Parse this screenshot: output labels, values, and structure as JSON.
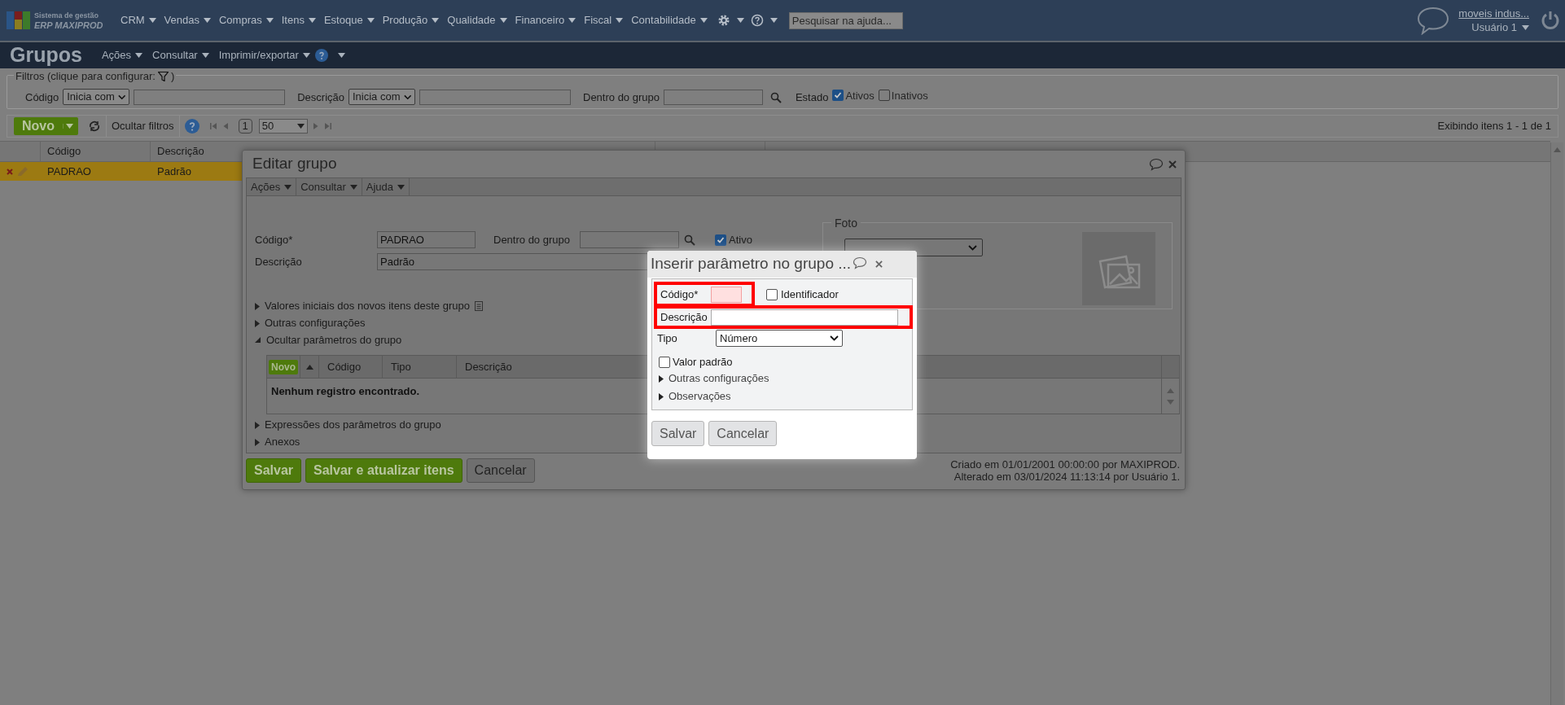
{
  "top_bar": {
    "logo": {
      "line1": "Sistema de gestão",
      "line2": "ERP MAXIPROD"
    },
    "menu": [
      {
        "label": "CRM"
      },
      {
        "label": "Vendas"
      },
      {
        "label": "Compras"
      },
      {
        "label": "Itens"
      },
      {
        "label": "Estoque"
      },
      {
        "label": "Produção"
      },
      {
        "label": "Qualidade"
      },
      {
        "label": "Financeiro"
      },
      {
        "label": "Fiscal"
      },
      {
        "label": "Contabilidade"
      }
    ],
    "help_search": {
      "placeholder": "Pesquisar na ajuda..."
    },
    "company": "moveis indus...",
    "user": "Usuário 1"
  },
  "page": {
    "title": "Grupos",
    "menu": [
      "Ações",
      "Consultar",
      "Imprimir/exportar"
    ]
  },
  "filters": {
    "legend": "Filtros (clique para configurar:",
    "legend_end": ")",
    "codigo": {
      "label": "Código",
      "operator": "Inicia com"
    },
    "descricao": {
      "label": "Descrição",
      "operator": "Inicia com"
    },
    "dentro_do_grupo": {
      "label": "Dentro do grupo"
    },
    "estado": {
      "label": "Estado",
      "options": [
        {
          "label": "Ativos",
          "checked": true
        },
        {
          "label": "Inativos",
          "checked": false
        }
      ]
    }
  },
  "toolbar": {
    "new_button": "Novo",
    "hide_filters": "Ocultar filtros",
    "page": "1",
    "page_size": "50",
    "summary": "Exibindo itens 1 - 1 de 1"
  },
  "table": {
    "columns": [
      "Código",
      "Descrição"
    ],
    "rows": [
      {
        "codigo": "PADRAO",
        "descricao": "Padrão",
        "selected": true
      }
    ]
  },
  "edit_dialog": {
    "title": "Editar grupo",
    "menu": [
      "Ações",
      "Consultar",
      "Ajuda"
    ],
    "codigo": {
      "label": "Código*",
      "value": "PADRAO"
    },
    "dentro_do_grupo": {
      "label": "Dentro do grupo"
    },
    "ativo": {
      "label": "Ativo",
      "checked": true
    },
    "descricao": {
      "label": "Descrição",
      "value": "Padrão"
    },
    "foto": {
      "legend": "Foto"
    },
    "sections_top": [
      {
        "label": "Valores iniciais dos novos itens deste grupo",
        "expanded": false,
        "kind": "with_note"
      },
      {
        "label": "Outras configurações",
        "expanded": false,
        "kind": "plain"
      },
      {
        "label": "Ocultar parâmetros do grupo",
        "expanded": true,
        "kind": "plain"
      }
    ],
    "params_grid": {
      "new_button": "Novo",
      "columns": [
        "Código",
        "Tipo",
        "Descrição"
      ],
      "empty": "Nenhum registro encontrado."
    },
    "sections_bottom": [
      {
        "label": "Expressões dos parâmetros do grupo",
        "expanded": false
      },
      {
        "label": "Anexos",
        "expanded": false
      }
    ],
    "buttons": [
      {
        "label": "Salvar",
        "kind": "primary"
      },
      {
        "label": "Salvar e atualizar itens",
        "kind": "primary"
      },
      {
        "label": "Cancelar",
        "kind": "secondary"
      }
    ],
    "created": "Criado em 01/01/2001 00:00:00 por MAXIPROD.",
    "modified": "Alterado em 03/01/2024 11:13:14 por Usuário 1."
  },
  "param_dialog": {
    "title": "Inserir parâmetro no grupo ...",
    "codigo": {
      "label": "Código*",
      "invalid": true,
      "highlighted": true
    },
    "identificador": {
      "label": "Identificador",
      "checked": false
    },
    "descricao": {
      "label": "Descrição",
      "highlighted": true
    },
    "tipo": {
      "label": "Tipo",
      "value": "Número"
    },
    "valor_padrao": {
      "label": "Valor padrão",
      "checked": false
    },
    "sections": [
      {
        "label": "Outras configurações",
        "expanded": false
      },
      {
        "label": "Observações",
        "expanded": false
      }
    ],
    "buttons": [
      "Salvar",
      "Cancelar"
    ]
  }
}
